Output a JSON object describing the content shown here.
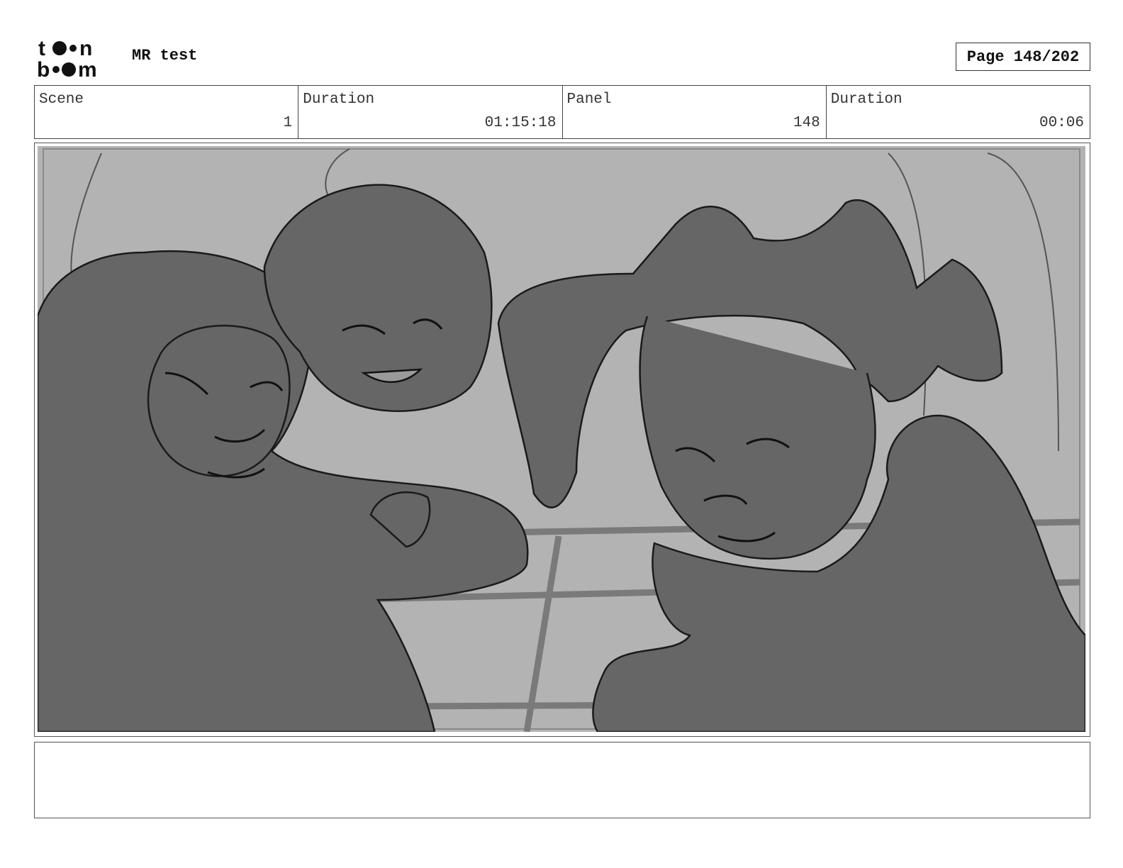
{
  "header": {
    "logo": {
      "text_top": "toon",
      "text_bottom": "boom",
      "icon": "toonboom-logo"
    },
    "project_title": "MR test",
    "page_label": "Page 148/202"
  },
  "info": {
    "scene_label": "Scene",
    "scene_value": "1",
    "scene_duration_label": "Duration",
    "scene_duration_value": "01:15:18",
    "panel_label": "Panel",
    "panel_value": "148",
    "panel_duration_label": "Duration",
    "panel_duration_value": "00:06"
  },
  "panel_image": {
    "description_icon": "storyboard-sketch",
    "colors": {
      "background": "#b3b3b3",
      "figures": "#666666",
      "lines": "#1a1a1a",
      "floor_lines": "#7a7a7a"
    }
  },
  "notes": {
    "text": ""
  }
}
